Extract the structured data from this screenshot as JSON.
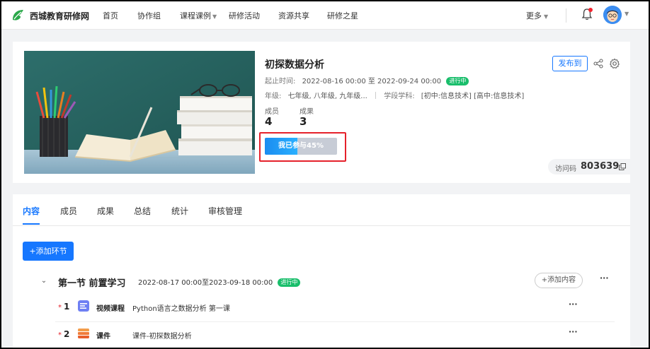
{
  "topnav": {
    "site_name": "西城教育研修网",
    "items": [
      {
        "label": "首页",
        "dropdown": false
      },
      {
        "label": "协作组",
        "dropdown": false
      },
      {
        "label": "课程课例",
        "dropdown": true
      },
      {
        "label": "研修活动",
        "dropdown": false
      },
      {
        "label": "资源共享",
        "dropdown": false
      },
      {
        "label": "研修之星",
        "dropdown": false
      }
    ],
    "more_label": "更多",
    "icons": [
      "logo-icon",
      "bell-icon",
      "avatar",
      "chevron-down-icon"
    ]
  },
  "activity": {
    "title": "初探数据分析",
    "time_label": "起止时间:",
    "time_range": "2022-08-16 00:00 至 2022-09-24 00:00",
    "status": "进行中",
    "grade_label": "年级:",
    "grades": "七年级, 八年级, 九年级...",
    "subject_label": "学段学科:",
    "subjects": "[初中:信息技术] [高中:信息技术]",
    "members_label": "成员",
    "members_count": "4",
    "results_label": "成果",
    "results_count": "3",
    "progress_text": "我已参与45%",
    "progress_fraction": 0.45,
    "publish_label": "发布到",
    "access_label": "访问码",
    "access_code": "803639",
    "colors": {
      "accent": "#1677ff",
      "status": "#19be6b",
      "highlight": "#e5212b"
    }
  },
  "content": {
    "tabs": [
      {
        "label": "内容",
        "active": true
      },
      {
        "label": "成员",
        "active": false
      },
      {
        "label": "成果",
        "active": false
      },
      {
        "label": "总结",
        "active": false
      },
      {
        "label": "统计",
        "active": false
      },
      {
        "label": "审核管理",
        "active": false
      }
    ],
    "add_section_label": "+添加环节",
    "section": {
      "title": "第一节 前置学习",
      "time": "2022-08-17 00:00至2023-09-18 00:00",
      "status": "进行中",
      "add_content_label": "+添加内容",
      "items": [
        {
          "index": "1",
          "type": "视频课程",
          "name": "Python语言之数据分析 第一课",
          "icon": "video-course-icon"
        },
        {
          "index": "2",
          "type": "课件",
          "name": "课件-初探数据分析",
          "icon": "courseware-icon"
        }
      ]
    }
  }
}
